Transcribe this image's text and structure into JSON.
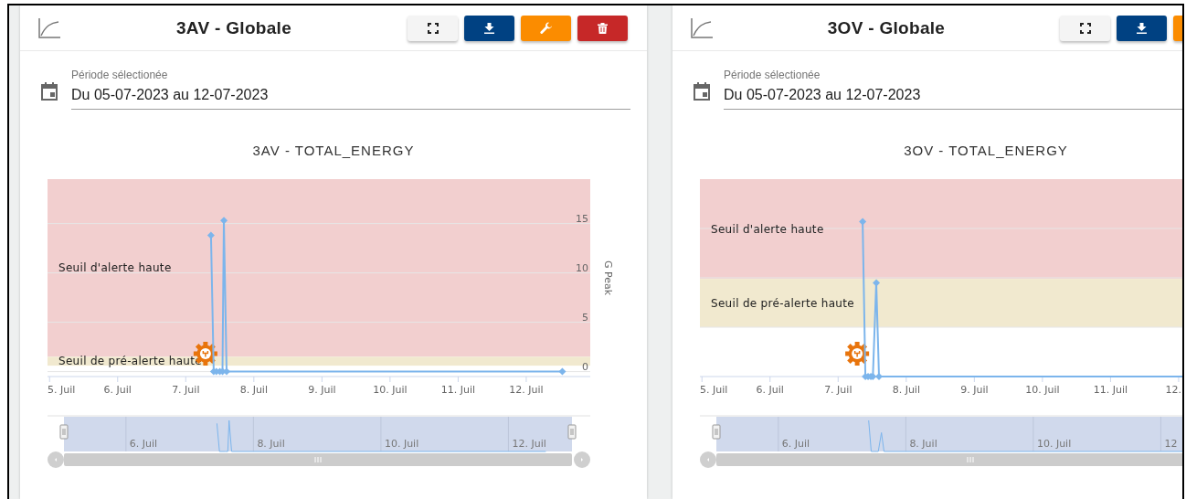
{
  "cards": [
    {
      "title": "3AV - Globale",
      "buttons": [
        {
          "kind": "fullscreen"
        },
        {
          "kind": "download"
        },
        {
          "kind": "settings"
        },
        {
          "kind": "delete"
        }
      ],
      "period": {
        "label": "Période sélectionée",
        "value": "Du 05-07-2023 au 12-07-2023"
      },
      "chart_title": "3AV - TOTAL_ENERGY",
      "chart_data": {
        "type": "line",
        "ylabel": "G Peak",
        "grid": true,
        "xlim": [
          4.97,
          12.94
        ],
        "ylim": [
          -0.5,
          19.5
        ],
        "xticks": [
          {
            "value": 5,
            "label": "5. Juil"
          },
          {
            "value": 6,
            "label": "6. Juil"
          },
          {
            "value": 7,
            "label": "7. Juil"
          },
          {
            "value": 8,
            "label": "8. Juil"
          },
          {
            "value": 9,
            "label": "9. Juil"
          },
          {
            "value": 10,
            "label": "10. Juil"
          },
          {
            "value": 11,
            "label": "11. Juil"
          },
          {
            "value": 12,
            "label": "12. Juil"
          }
        ],
        "yticks": [
          0,
          5,
          10,
          15
        ],
        "x": [
          7.37,
          7.41,
          7.45,
          7.5,
          7.54,
          7.56,
          7.6,
          12.53
        ],
        "series": [
          {
            "color": "#7cb5ec",
            "marker": "diamond",
            "values": [
              13.8,
              0,
              0,
              0,
              0,
              15.3,
              0,
              0
            ]
          }
        ],
        "bands": [
          {
            "axis": "y",
            "from": 1.5,
            "to": 19.5,
            "label": "Seuil d'alerte haute",
            "color": "#f2cfcf"
          },
          {
            "axis": "y",
            "from": 0.6,
            "to": 1.5,
            "label": "Seuil de pré-alerte haute",
            "color": "#f1e9cf"
          }
        ]
      },
      "navigator": {
        "ticks": [
          "6. Juil",
          "8. Juil",
          "10. Juil",
          "12. Juil"
        ]
      }
    },
    {
      "title": "3OV - Globale",
      "buttons": [
        {
          "kind": "fullscreen"
        },
        {
          "kind": "download"
        },
        {
          "kind": "settings"
        }
      ],
      "period": {
        "label": "Période sélectionée",
        "value": "Du 05-07-2023 au 12-07-2023"
      },
      "chart_title": "3OV - TOTAL_ENERGY",
      "chart_picture": {
        "x_labels": [
          "5. Juil",
          "6. Juil",
          "7. Juil",
          "8. Juil",
          "9. Juil",
          "10. Juil",
          "11. Juil",
          "12."
        ],
        "bands": [
          {
            "label": "Seuil d'alerte haute",
            "color": "#f2cfcf"
          },
          {
            "label": "Seuil de pré-alerte haute",
            "color": "#f1e9cf"
          }
        ]
      },
      "navigator": {
        "ticks": [
          "6. Juil",
          "8. Juil",
          "10. Juil",
          "12"
        ]
      }
    }
  ]
}
